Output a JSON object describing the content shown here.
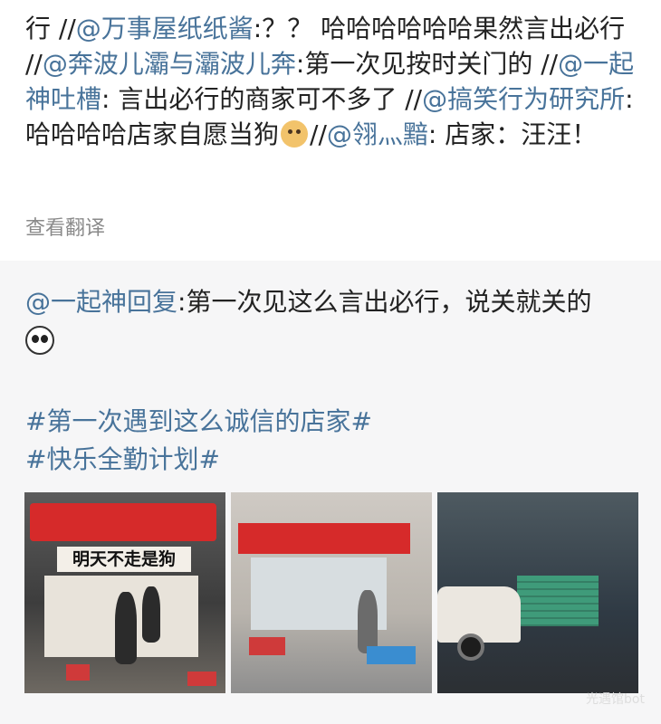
{
  "comment": {
    "p1": "行 //",
    "u1": "@万事屋纸纸酱",
    "p2": ":？？ 哈哈哈哈哈哈果然言出必行 //",
    "u2": "@奔波儿灞与灞波儿奔",
    "p3": ":第一次见按时关门的 //",
    "u3": "@一起神吐槽",
    "p4": ": 言出必行的商家可不多了 //",
    "u4": "@搞笑行为研究所",
    "p5": ": 哈哈哈哈店家自愿当狗",
    "p6": "//",
    "u5": "@翎灬黯",
    "p7": ": 店家：汪汪！",
    "emoji": "doge-emoji"
  },
  "translate_label": "查看翻译",
  "quote": {
    "user": "@一起神回复",
    "text": ":第一次见这么言出必行，说关就关的",
    "emoji": "panda-laugh-emoji",
    "tags": [
      "#第一次遇到这么诚信的店家#",
      "#快乐全勤计划#"
    ]
  },
  "photos": {
    "banner_text": "明天不走是狗"
  },
  "watermark": "光遇馆bot"
}
